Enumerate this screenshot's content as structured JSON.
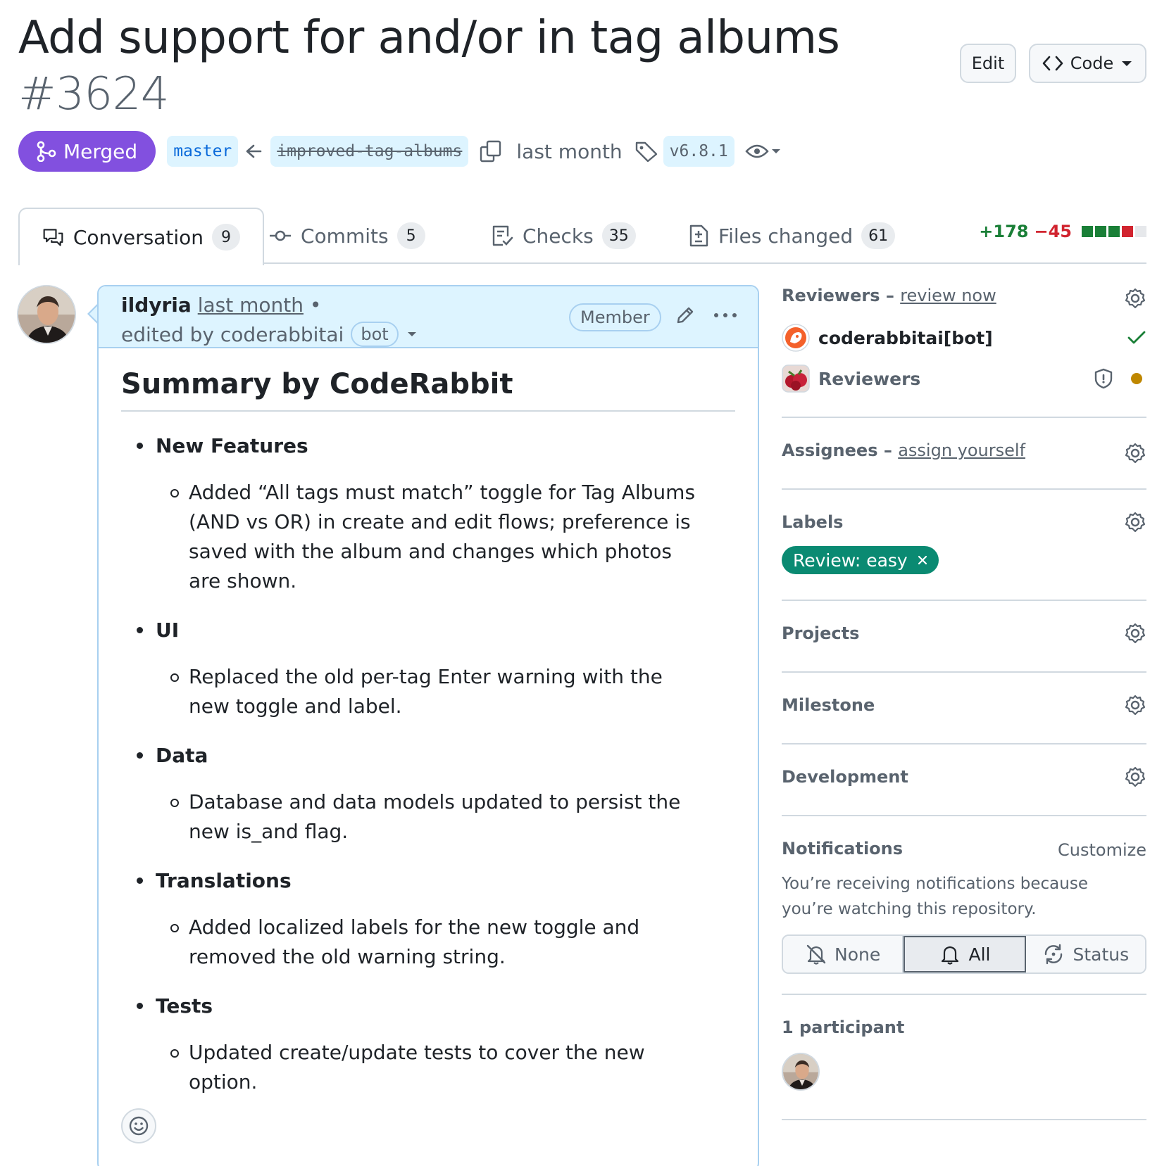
{
  "header": {
    "title": "Add support for and/or in tag albums",
    "number": "#3624",
    "edit_label": "Edit",
    "code_label": "Code"
  },
  "meta": {
    "state": "Merged",
    "base_branch": "master",
    "head_branch": "improved-tag-albums",
    "time": "last month",
    "tag": "v6.8.1"
  },
  "tabs": [
    {
      "label": "Conversation",
      "count": "9"
    },
    {
      "label": "Commits",
      "count": "5"
    },
    {
      "label": "Checks",
      "count": "35"
    },
    {
      "label": "Files changed",
      "count": "61"
    }
  ],
  "diffstat": {
    "additions": "+178",
    "deletions": "−45"
  },
  "comment": {
    "author": "ildyria",
    "time": "last month",
    "bullet": "•",
    "edited_by": "edited by coderabbitai",
    "bot_badge": "bot",
    "role": "Member",
    "heading": "Summary by CodeRabbit",
    "sections": [
      {
        "title": "New Features",
        "item": "Added “All tags must match” toggle for Tag Albums (AND vs OR) in create and edit flows; preference is saved with the album and changes which photos are shown."
      },
      {
        "title": "UI",
        "item": "Replaced the old per-tag Enter warning with the new toggle and label."
      },
      {
        "title": "Data",
        "item": "Database and data models updated to persist the new is_and flag."
      },
      {
        "title": "Translations",
        "item": "Added localized labels for the new toggle and removed the old warning string."
      },
      {
        "title": "Tests",
        "item": "Updated create/update tests to cover the new option."
      }
    ]
  },
  "sidebar": {
    "reviewers_title": "Reviewers",
    "reviewers_link": "review now",
    "reviewer_1": "coderabbitai[bot]",
    "reviewer_2": "Reviewers",
    "assignees_title": "Assignees",
    "assignees_link": "assign yourself",
    "labels_title": "Labels",
    "label": "Review: easy",
    "projects_title": "Projects",
    "milestone_title": "Milestone",
    "development_title": "Development",
    "notifications_title": "Notifications",
    "customize": "Customize",
    "notif_text": "You’re receiving notifications because you’re watching this repository.",
    "notif_none": "None",
    "notif_all": "All",
    "notif_status": "Status",
    "participants": "1 participant"
  },
  "colors": {
    "merged": "#8250df",
    "label": "#0a8a72",
    "link": "#0969da"
  }
}
